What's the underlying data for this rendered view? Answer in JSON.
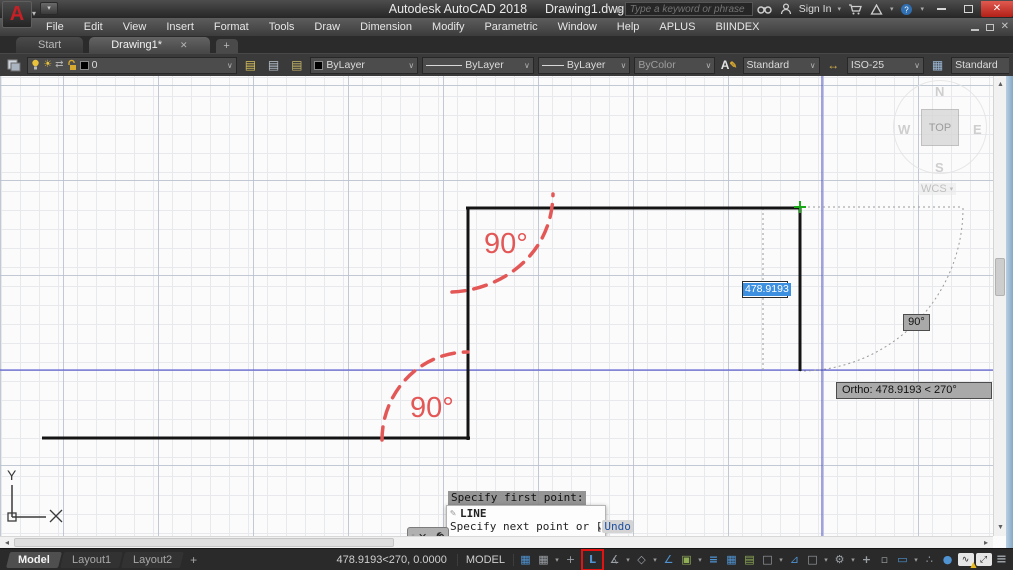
{
  "titlebar": {
    "title_app": "Autodesk AutoCAD 2018",
    "title_doc": "Drawing1.dwg",
    "search_placeholder": "Type a keyword or phrase",
    "sign_in_label": "Sign In"
  },
  "menu": {
    "items": [
      "File",
      "Edit",
      "View",
      "Insert",
      "Format",
      "Tools",
      "Draw",
      "Dimension",
      "Modify",
      "Parametric",
      "Window",
      "Help",
      "APLUS",
      "BIINDEX"
    ]
  },
  "file_tabs": {
    "start": "Start",
    "active": "Drawing1*"
  },
  "toolbar": {
    "layer_current": "0",
    "color": "ByLayer",
    "linetype": "ByLayer",
    "lineweight": "ByLayer",
    "plot_style": "ByColor",
    "text_style": "Standard",
    "dim_style": "ISO-25",
    "table_style": "Standard"
  },
  "canvas": {
    "angle_label_top": "90°",
    "angle_label_bottom": "90°",
    "dyn_input_value": "478.9193",
    "angle_badge": "90°",
    "ortho_tooltip": "Ortho: 478.9193 < 270°",
    "viewcube": {
      "n": "N",
      "s": "S",
      "e": "E",
      "w": "W",
      "top": "TOP",
      "wcs": "WCS"
    },
    "ucs_y": "Y",
    "accent_colors": {
      "crosshair": "#4646d2",
      "marker": "#18a818",
      "annotation": "#e45757",
      "selection": "#3d8fe0"
    }
  },
  "command": {
    "history_line": "Specify first point:",
    "command_name": "LINE",
    "prompt_before": "Specify next point or [",
    "option": "Undo",
    "prompt_after": "]:"
  },
  "statusbar": {
    "tabs": [
      "Model",
      "Layout1",
      "Layout2"
    ],
    "coords": "478.9193<270, 0.0000",
    "space_label": "MODEL"
  },
  "glyphs": {
    "dropdown_small": "∨",
    "caret": "▾",
    "caret_up": "▴",
    "close": "✕",
    "plus": "+",
    "scroll_up": "▲",
    "scroll_down": "▼",
    "scroll_left": "◂",
    "scroll_right": "▸",
    "search_play": "▶",
    "grip_dots": "⁞⁞",
    "pencil": "✎",
    "sun": "☀",
    "transfer": "⇄",
    "layer_stack": "▤",
    "hamburger": "≡",
    "grid": "▦",
    "snap": "▦",
    "dyninput": "+",
    "ortho": "L",
    "polar": "∡",
    "iso": "◇",
    "otrack": "∠",
    "osnap": "▣",
    "lineweight": "≡",
    "transparency": "▦",
    "cycling": "▤",
    "osnap3d": "□",
    "dynucs": "⊿",
    "filter": "□",
    "gizmo": "⚙",
    "annovis": "+",
    "autoscale": "▫",
    "annoscale": "▭",
    "workspace": "∴",
    "annomonitor": "●",
    "wave": "∿",
    "warn": "▲",
    "cleanscreen": "⤢",
    "text_style_a": "A",
    "dim_style_arrow": "↔",
    "table_style": "▦"
  }
}
